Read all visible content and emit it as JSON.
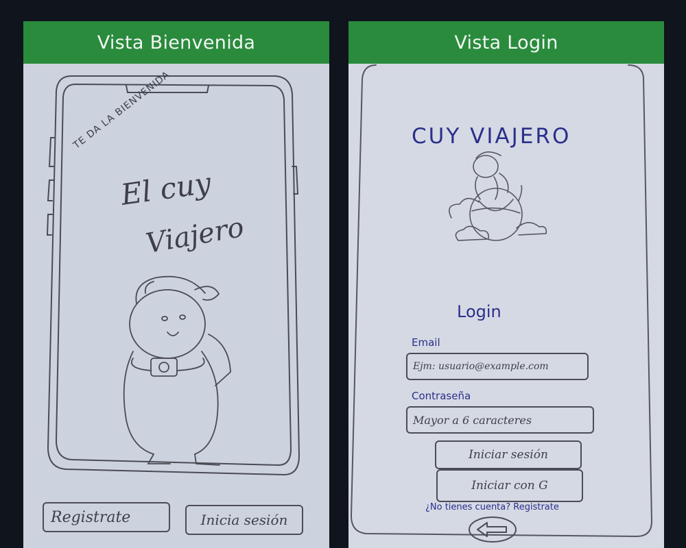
{
  "panels": {
    "welcome": {
      "title": "Vista Bienvenida",
      "arc_text": "TE DA LA BIENVENIDA",
      "app_name_line1": "El cuy",
      "app_name_line2": "Viajero",
      "register_button": "Registrate",
      "login_button": "Inicia sesión"
    },
    "login": {
      "title": "Vista Login",
      "app_title": "CUY VIAJERO",
      "heading": "Login",
      "email_label": "Email",
      "email_placeholder": "Ejm: usuario@example.com",
      "password_label": "Contraseña",
      "password_placeholder": "Mayor a 6 caracteres",
      "login_button": "Iniciar sesión",
      "google_button": "Iniciar con G",
      "register_prompt": "¿No tienes cuenta? Registrate"
    }
  },
  "colors": {
    "background": "#0f141d",
    "header": "#2a8b3d",
    "paper": "#cdd2df",
    "pencil": "#3e3f48",
    "blue_ink": "#2a2f8a"
  }
}
